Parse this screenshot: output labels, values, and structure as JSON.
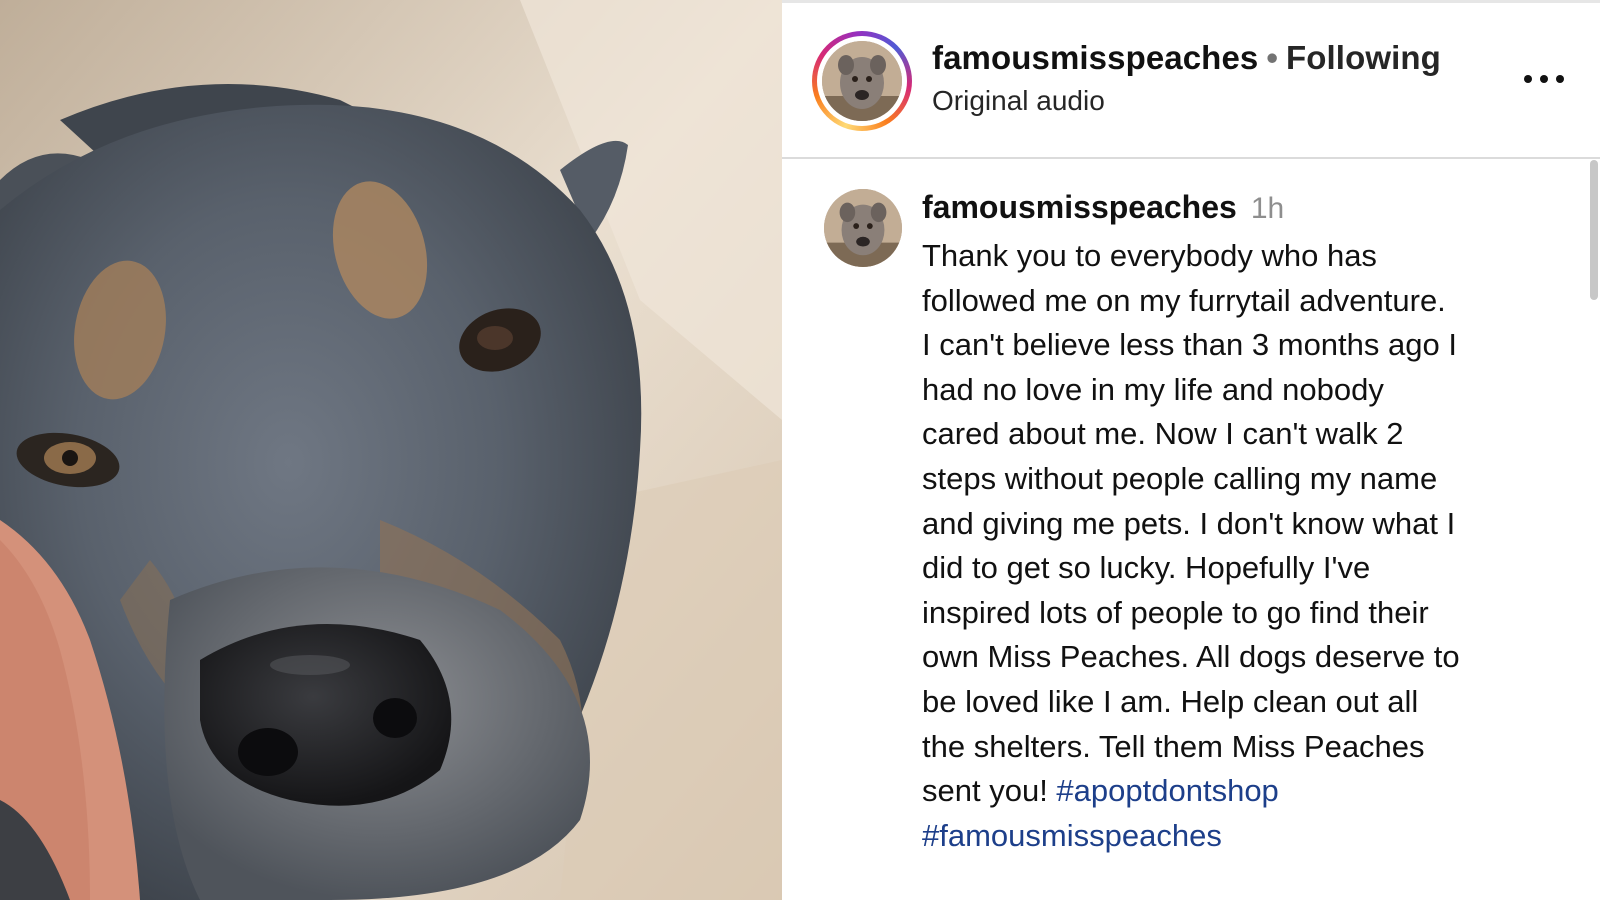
{
  "header": {
    "username": "famousmisspeaches",
    "separator": "•",
    "follow_status": "Following",
    "audio_label": "Original audio",
    "more_icon": "more-horizontal-icon"
  },
  "caption": {
    "username": "famousmisspeaches",
    "time": "1h",
    "lines": [
      "Thank you to everybody who has",
      "followed me on my furrytail adventure.",
      "I can't believe less than 3 months ago I",
      "had no love in my life and nobody",
      "cared about me. Now I can't walk 2",
      "steps without people calling my name",
      "and giving me pets. I don't know what I",
      "did to get so lucky. Hopefully I've",
      "inspired lots of people to go find their",
      "own Miss Peaches. All dogs deserve to",
      "be loved like I am. Help clean out all",
      "the shelters. Tell them Miss Peaches",
      "sent you! "
    ],
    "hashtags": [
      "#apoptdontshop",
      "#famousmisspeaches"
    ]
  },
  "colors": {
    "hashtag": "#1d3f8a",
    "timestamp": "#8e8e8e",
    "divider": "#dbdbdb"
  }
}
